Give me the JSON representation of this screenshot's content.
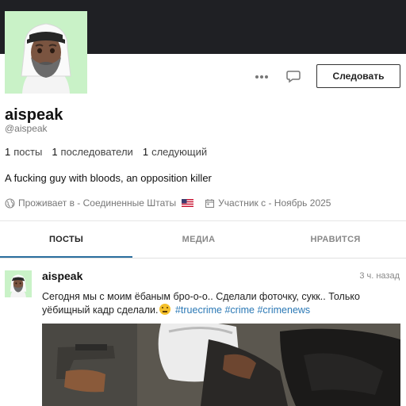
{
  "profile": {
    "name": "aispeak",
    "handle": "@aispeak",
    "follow_label": "Следовать",
    "stats": [
      {
        "count": "1",
        "label": "посты"
      },
      {
        "count": "1",
        "label": "последователи"
      },
      {
        "count": "1",
        "label": "следующий"
      }
    ],
    "bio": "A fucking guy with bloods, an opposition killer",
    "location": "Проживает в - Соединенные Штаты",
    "joined": "Участник с - Ноябрь 2025",
    "icons": [
      "globe-icon",
      "calendar-icon",
      "us-flag-icon",
      "more-icon",
      "chat-bubble-icon"
    ]
  },
  "tabs": [
    {
      "label": "ПОСТЫ",
      "active": true
    },
    {
      "label": "МЕДИА",
      "active": false
    },
    {
      "label": "НРАВИТСЯ",
      "active": false
    }
  ],
  "post": {
    "author": "aispeak",
    "time": "3 ч. назад",
    "text": "Сегодня мы с моим ёбаным бро-о-о.. Сделали фоточку, сукк.. Только уёбищный кадр сделали.",
    "tags": [
      "#truecrime",
      "#crime",
      "#crimenews"
    ]
  },
  "colors": {
    "banner": "#1f2024",
    "avatar_bg": "#c9f2c7",
    "tab_underline": "#2b6f9f",
    "hashtag": "#2a78b5"
  }
}
